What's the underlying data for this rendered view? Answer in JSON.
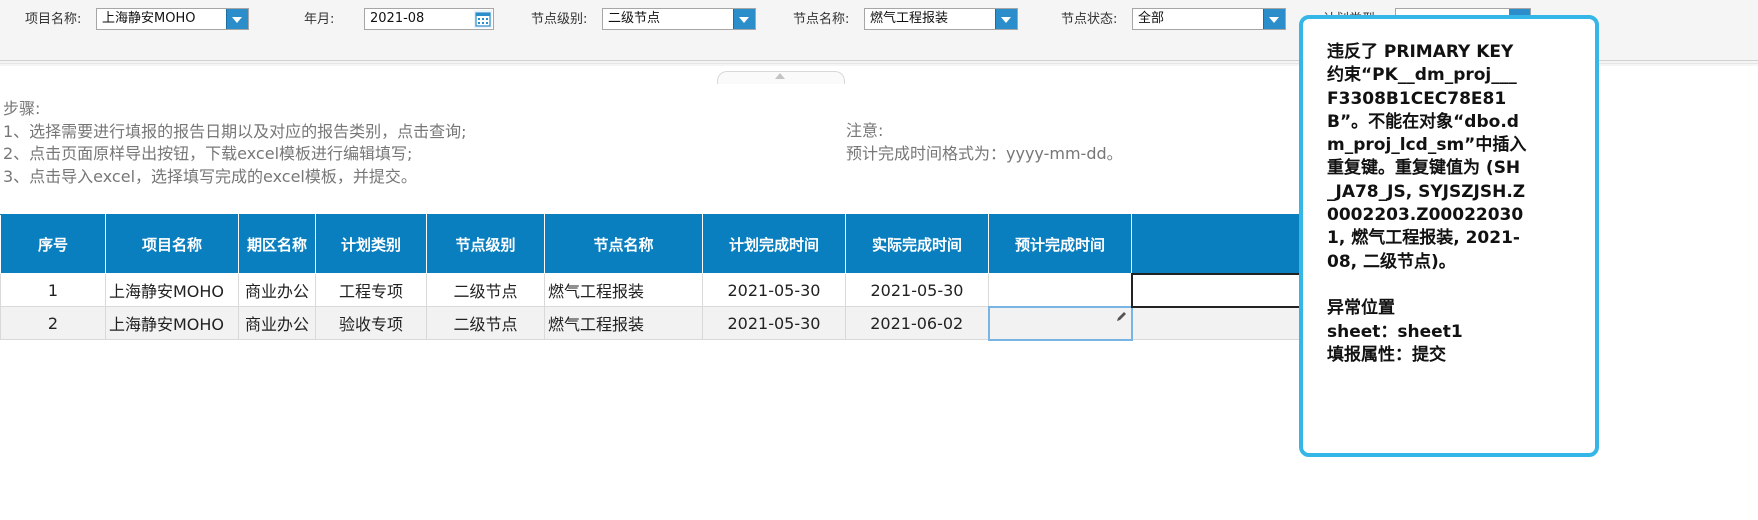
{
  "filters": {
    "project_label": "项目名称:",
    "project_value": "上海静安MOHO",
    "yearmonth_label": "年月:",
    "yearmonth_value": "2021-08",
    "node_level_label": "节点级别:",
    "node_level_value": "二级节点",
    "node_name_label": "节点名称:",
    "node_name_value": "燃气工程报装",
    "node_status_label": "节点状态:",
    "node_status_value": "全部",
    "plan_type_label": "计划类型"
  },
  "instructions": {
    "steps_title": "步骤:",
    "step1": "1、选择需要进行填报的报告日期以及对应的报告类别，点击查询;",
    "step2": "2、点击页面原样导出按钮，下载excel模板进行编辑填写;",
    "step3": "3、点击导入excel，选择填写完成的excel模板，并提交。",
    "note_title": "注意:",
    "note_text": "预计完成时间格式为：yyyy-mm-dd。"
  },
  "table": {
    "headers": [
      "序号",
      "项目名称",
      "期区名称",
      "计划类别",
      "节点级别",
      "节点名称",
      "计划完成时间",
      "实际完成时间",
      "预计完成时间"
    ],
    "rows": [
      [
        "1",
        "上海静安MOHO",
        "商业办公",
        "工程专项",
        "二级节点",
        "燃气工程报装",
        "2021-05-30",
        "2021-05-30",
        ""
      ],
      [
        "2",
        "上海静安MOHO",
        "商业办公",
        "验收专项",
        "二级节点",
        "燃气工程报装",
        "2021-05-30",
        "2021-06-02",
        ""
      ]
    ]
  },
  "error_tooltip": {
    "message": "违反了 PRIMARY KEY 约束“PK__dm_proj___F3308B1CEC78E81B”。不能在对象“dbo.dm_proj_lcd_sm”中插入重复键。重复键值为 (SH_JA78_JS, SYJSZJSH.Z0002203.Z000220301, 燃气工程报装, 2021-08, 二级节点)。\n\n异常位置\nsheet：sheet1\n填报属性：提交",
    "border_color": "#36b6e6"
  },
  "colors": {
    "header_bg": "#0a7fc0",
    "dropdown_button": "#2c8dcb"
  }
}
